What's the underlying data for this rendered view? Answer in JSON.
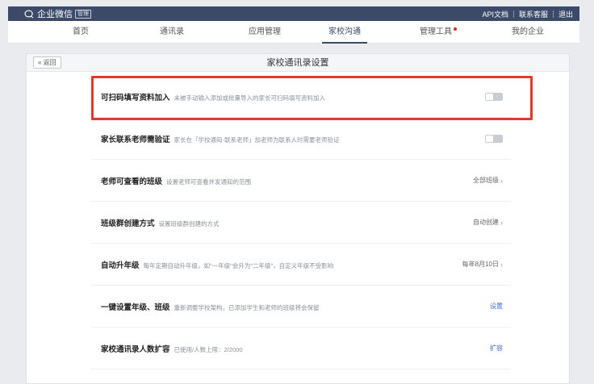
{
  "app": {
    "name": "企业微信",
    "tag": "管理"
  },
  "toplinks": [
    "API文档",
    "联系客服",
    "退出"
  ],
  "nav": [
    {
      "label": "首页",
      "active": false
    },
    {
      "label": "通讯录",
      "active": false
    },
    {
      "label": "应用管理",
      "active": false
    },
    {
      "label": "家校沟通",
      "active": true
    },
    {
      "label": "管理工具",
      "active": false,
      "dot": true
    },
    {
      "label": "我的企业",
      "active": false
    }
  ],
  "page": {
    "back": "« 返回",
    "title": "家校通讯录设置"
  },
  "rows": [
    {
      "title": "可扫码填写资料加入",
      "desc": "未被手动输入添加或批量导入的家长可扫码填写资料加入",
      "control": "toggle",
      "on": false
    },
    {
      "title": "家长联系老师需验证",
      "desc": "家长在「学校通知-联系老师」加老师为联系人时需要老师验证",
      "control": "toggle",
      "on": false
    },
    {
      "title": "老师可查看的班级",
      "desc": "设置老师可查看并发通知的范围",
      "control": "value",
      "value": "全部班级"
    },
    {
      "title": "班级群创建方式",
      "desc": "设置班级群创建的方式",
      "control": "value",
      "value": "自动创建"
    },
    {
      "title": "自动升年级",
      "desc": "每年定期自动升年级，如\"一年级\"会升为\"二年级\"，自定义年级不受影响",
      "control": "value",
      "value": "每年8月10日"
    },
    {
      "title": "一键设置年级、班级",
      "desc": "重新调整学校架构，已添加学生和老师的班级将会保留",
      "control": "link",
      "value": "设置"
    },
    {
      "title": "家校通讯录人数扩容",
      "desc": "已使用/人数上限：2/2000",
      "control": "link",
      "value": "扩容"
    }
  ],
  "colors": {
    "topbar": "#3a4a68",
    "highlight": "#e53a2b",
    "link": "#3b6cc7"
  }
}
